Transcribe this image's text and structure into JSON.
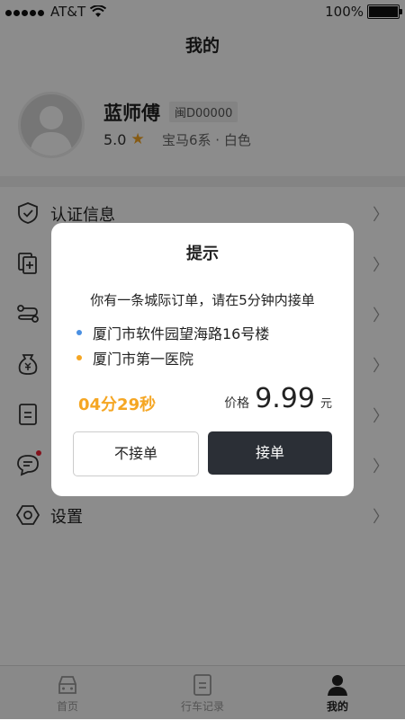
{
  "status": {
    "carrier": "AT&T",
    "battery": "100%"
  },
  "header": {
    "title": "我的"
  },
  "profile": {
    "name": "蓝师傅",
    "plate": "闽D00000",
    "rating": "5.0",
    "car": "宝马6系 · 白色"
  },
  "menu": [
    {
      "label": "认证信息",
      "icon": "shield-check-icon"
    },
    {
      "label": "",
      "icon": "document-add-icon"
    },
    {
      "label": "",
      "icon": "route-icon"
    },
    {
      "label": "",
      "icon": "wallet-yen-icon"
    },
    {
      "label": "",
      "icon": "receipt-icon"
    },
    {
      "label": "",
      "icon": "chat-icon"
    },
    {
      "label": "设置",
      "icon": "settings-hex-icon"
    }
  ],
  "tabbar": {
    "items": [
      {
        "label": "首页",
        "icon": "car-icon"
      },
      {
        "label": "行车记录",
        "icon": "log-icon"
      },
      {
        "label": "我的",
        "icon": "person-icon"
      }
    ]
  },
  "dialog": {
    "title": "提示",
    "message": "你有一条城际订单，请在5分钟内接单",
    "addresses": [
      {
        "text": "厦门市软件园望海路16号楼",
        "color": "#4a90e2"
      },
      {
        "text": "厦门市第一医院",
        "color": "#f5a623"
      }
    ],
    "timer": "04分29秒",
    "price_label": "价格",
    "price_value": "9.99",
    "price_unit": "元",
    "decline_label": "不接单",
    "accept_label": "接单"
  }
}
